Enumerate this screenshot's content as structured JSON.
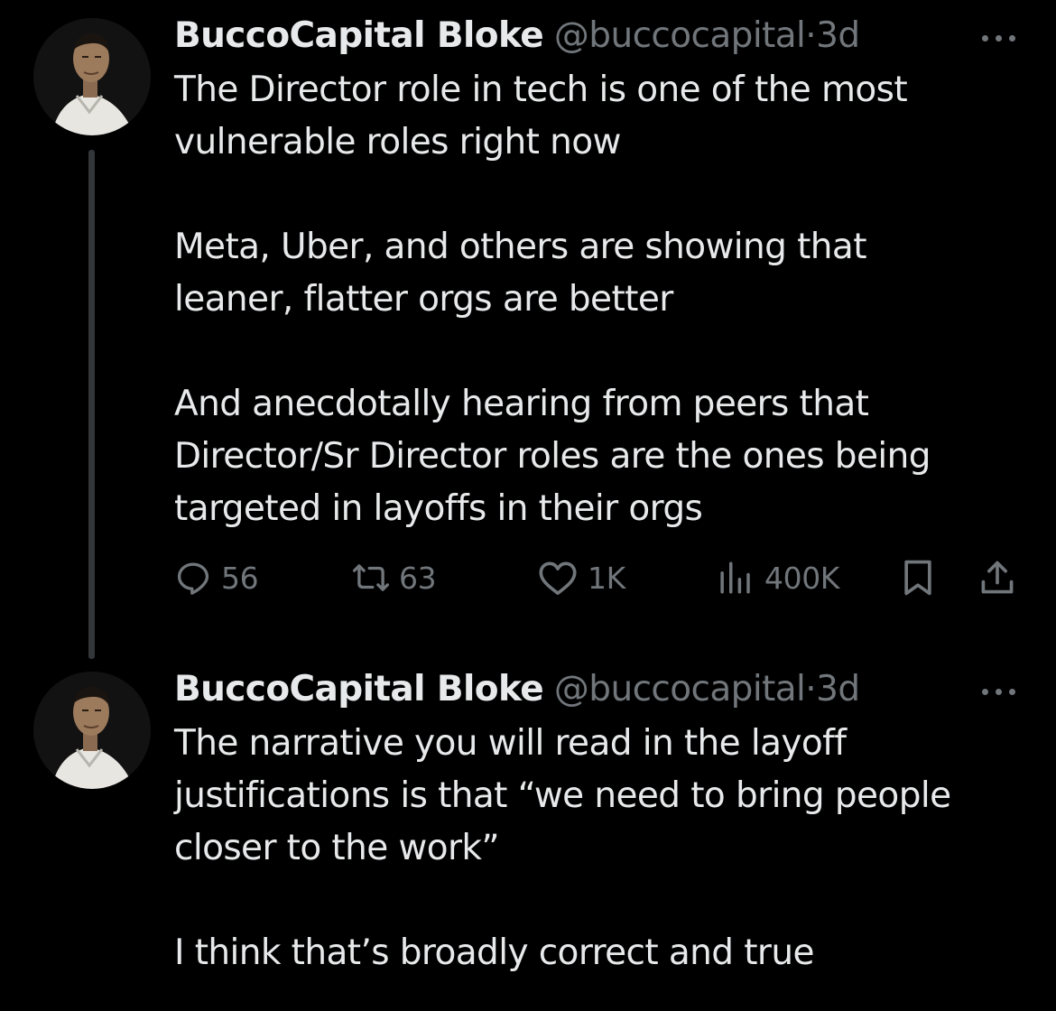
{
  "tweets": [
    {
      "author_name": "BuccoCapital Bloke",
      "handle": "@buccocapital",
      "separator": "·",
      "time": "3d",
      "paragraphs": [
        [
          "The Director role in tech is one of the most",
          "vulnerable roles right now"
        ],
        [
          "Meta, Uber, and others are showing that",
          "leaner, flatter orgs are better"
        ],
        [
          "And anecdotally hearing from peers that",
          "Director/Sr Director roles are the ones being",
          "targeted in layoffs in their orgs"
        ]
      ],
      "actions": {
        "replies": "56",
        "retweets": "63",
        "likes": "1K",
        "views": "400K"
      }
    },
    {
      "author_name": "BuccoCapital Bloke",
      "handle": "@buccocapital",
      "separator": "·",
      "time": "3d",
      "paragraphs": [
        [
          "The narrative you will read in the layoff",
          "justifications is that “we need to bring people",
          "closer to the work”"
        ],
        [
          "I think that’s broadly correct and true"
        ]
      ]
    }
  ],
  "icons": {
    "reply": "reply-icon",
    "retweet": "retweet-icon",
    "like": "heart-icon",
    "views": "views-icon",
    "bookmark": "bookmark-icon",
    "share": "share-icon",
    "more": "more-icon"
  },
  "colors": {
    "background": "#000000",
    "text": "#e7e9ea",
    "secondary": "#71767b",
    "thread_line": "#333639"
  }
}
